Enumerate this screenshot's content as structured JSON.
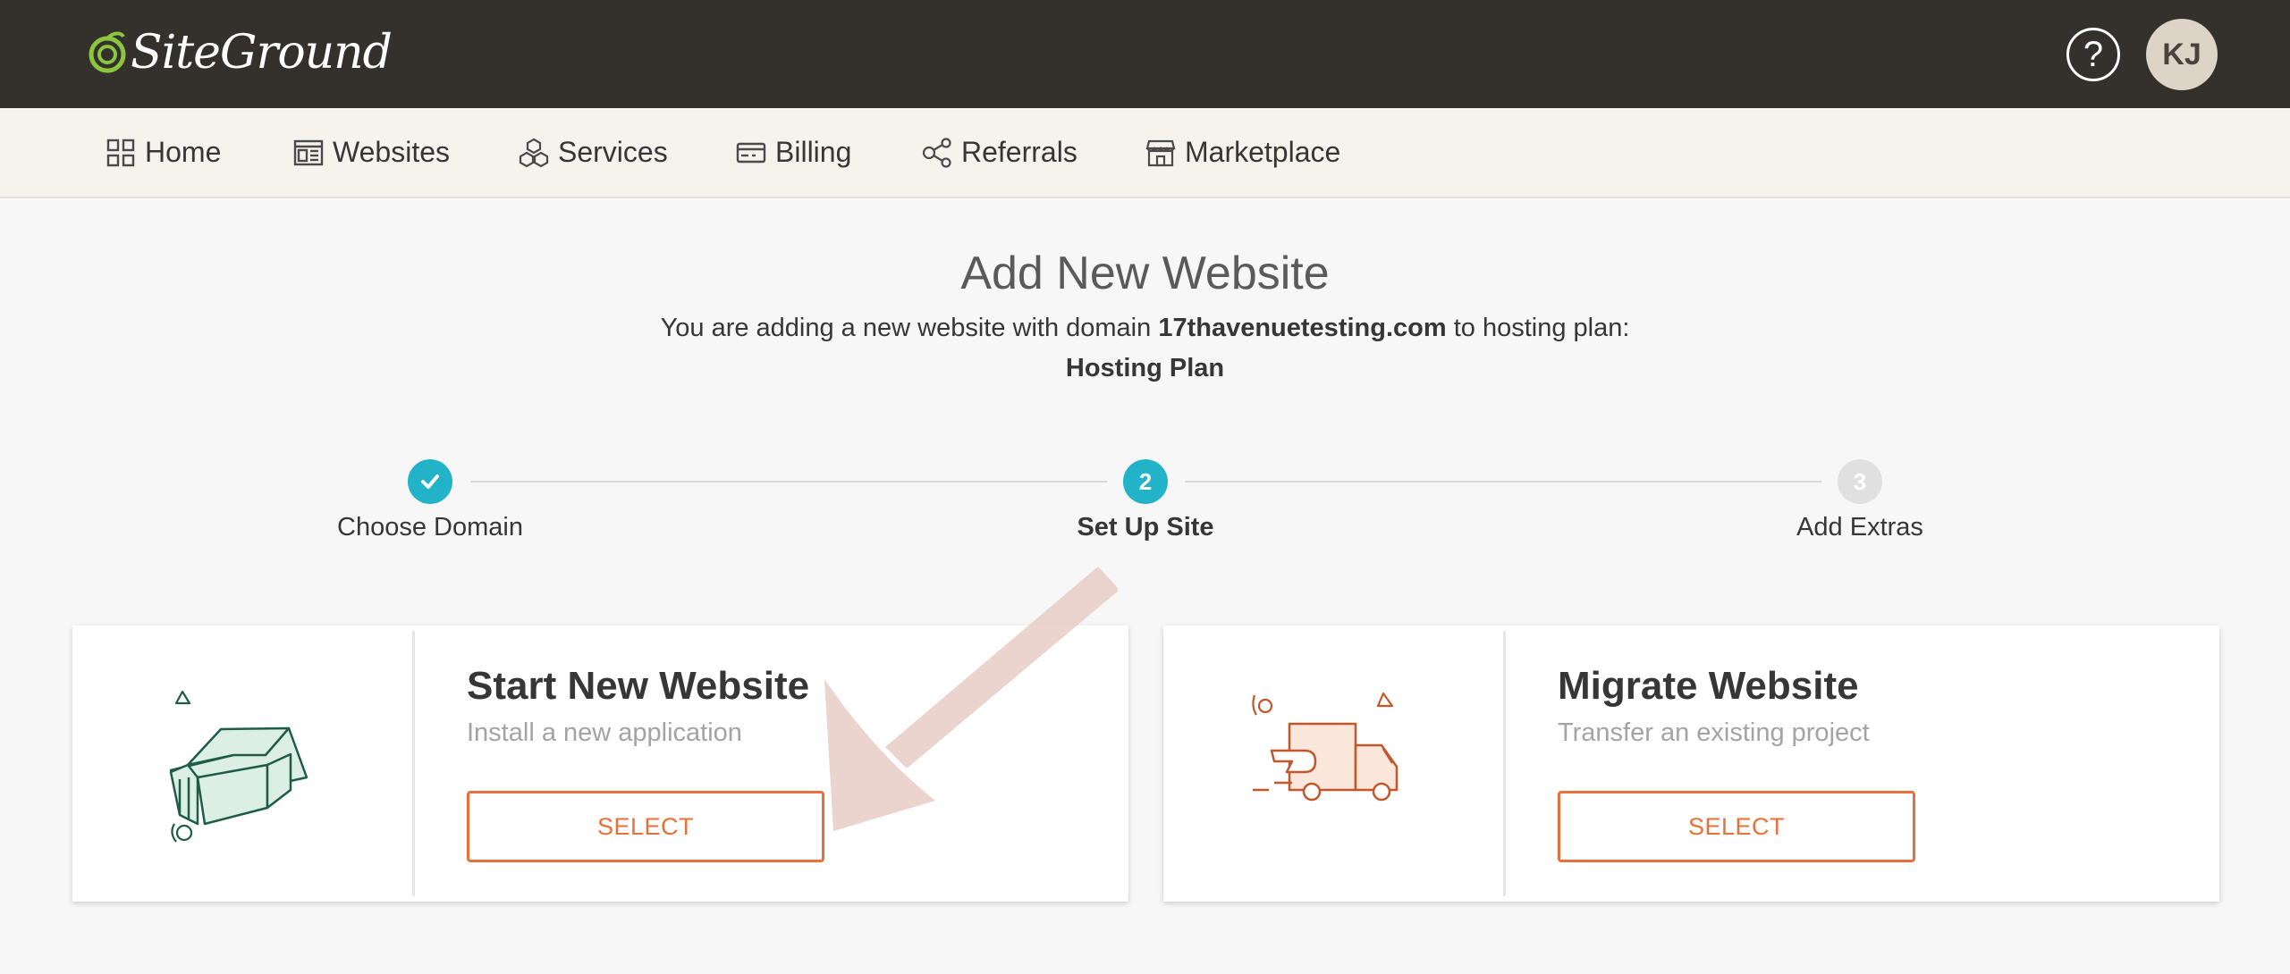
{
  "brand": {
    "name": "SiteGround",
    "logo_color": "#8cc63f"
  },
  "header": {
    "help_icon": "question-circle-icon",
    "help_label": "?",
    "avatar_initials": "KJ"
  },
  "nav": {
    "items": [
      {
        "label": "Home",
        "icon": "grid-icon"
      },
      {
        "label": "Websites",
        "icon": "websites-icon"
      },
      {
        "label": "Services",
        "icon": "cubes-icon"
      },
      {
        "label": "Billing",
        "icon": "credit-card-icon"
      },
      {
        "label": "Referrals",
        "icon": "share-icon"
      },
      {
        "label": "Marketplace",
        "icon": "store-icon"
      }
    ]
  },
  "main": {
    "title": "Add New Website",
    "subtitle_prefix": "You are adding a new website with domain ",
    "domain": "17thavenuetesting.com",
    "subtitle_suffix": " to hosting plan:",
    "plan_name": "Hosting Plan"
  },
  "steps": [
    {
      "number": "",
      "label": "Choose Domain",
      "state": "completed"
    },
    {
      "number": "2",
      "label": "Set Up Site",
      "state": "current"
    },
    {
      "number": "3",
      "label": "Add Extras",
      "state": "upcoming"
    }
  ],
  "cards": [
    {
      "title": "Start New Website",
      "description": "Install a new application",
      "button": "SELECT",
      "illustration": "house-icon"
    },
    {
      "title": "Migrate Website",
      "description": "Transfer an existing project",
      "button": "SELECT",
      "illustration": "delivery-truck-icon"
    }
  ],
  "colors": {
    "topbar": "#34302c",
    "navbar": "#f6f3ec",
    "step_active": "#22b3c9",
    "accent_orange": "#e8703a",
    "annotation_arrow": "#e8cbc6"
  }
}
